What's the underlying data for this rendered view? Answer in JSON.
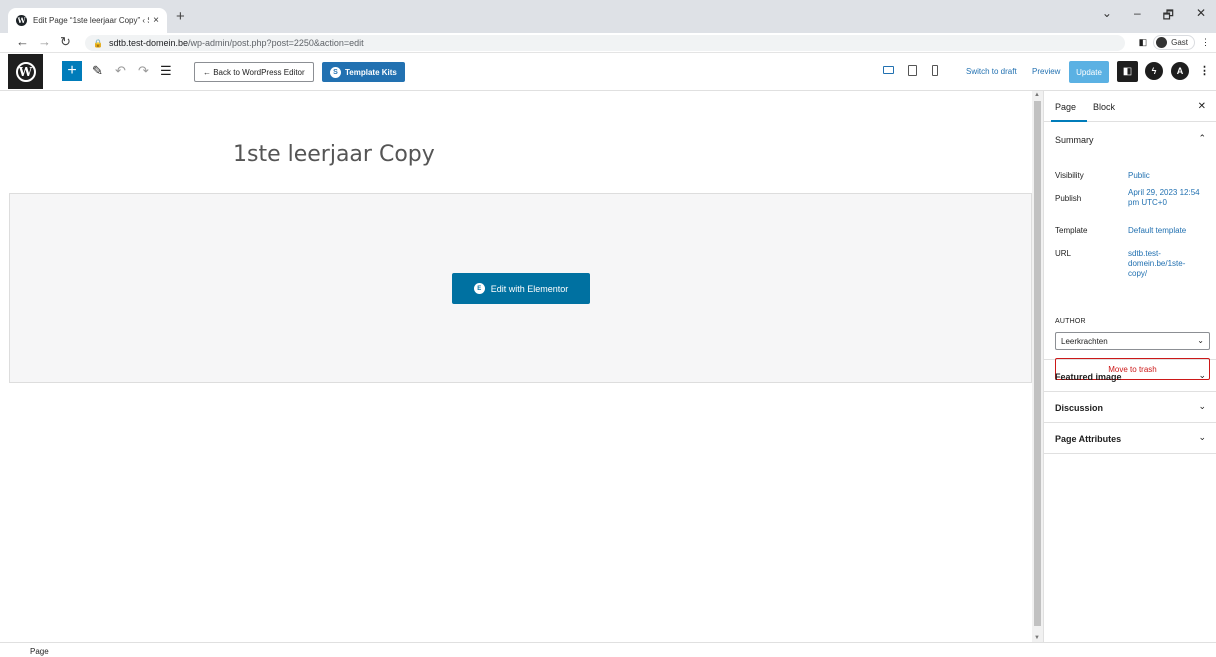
{
  "browser": {
    "tab_title": "Edit Page “1ste leerjaar Copy” ‹ S",
    "tab_close": "×",
    "new_tab": "+",
    "url_host": "sdtb.test-domein.be",
    "url_path": "/wp-admin/post.php?post=2250&action=edit",
    "guest_label": "Gast",
    "window_controls": [
      "⌄",
      "–",
      "🗗",
      "✕"
    ]
  },
  "toolbar": {
    "back_label": "← Back to WordPress Editor",
    "kits_label": "Template Kits",
    "switch_draft": "Switch to draft",
    "preview": "Preview",
    "update": "Update"
  },
  "canvas": {
    "page_title": "1ste leerjaar Copy",
    "edit_elementor": "Edit with Elementor"
  },
  "sidebar": {
    "tab_page": "Page",
    "tab_block": "Block",
    "summary_title": "Summary",
    "visibility_label": "Visibility",
    "visibility_value": "Public",
    "publish_label": "Publish",
    "publish_value": "April 29, 2023 12:54 pm UTC+0",
    "template_label": "Template",
    "template_value": "Default template",
    "url_label": "URL",
    "url_value": "sdtb.test-domein.be/1ste-copy/",
    "author_label": "AUTHOR",
    "author_value": "Leerkrachten",
    "trash_label": "Move to trash",
    "panels": [
      "Featured image",
      "Discussion",
      "Page Attributes"
    ]
  },
  "footer": {
    "breadcrumb": "Page"
  },
  "colors": {
    "accent": "#007cba",
    "link": "#2271b1",
    "danger": "#cc1818",
    "elementor": "#0071a1"
  }
}
